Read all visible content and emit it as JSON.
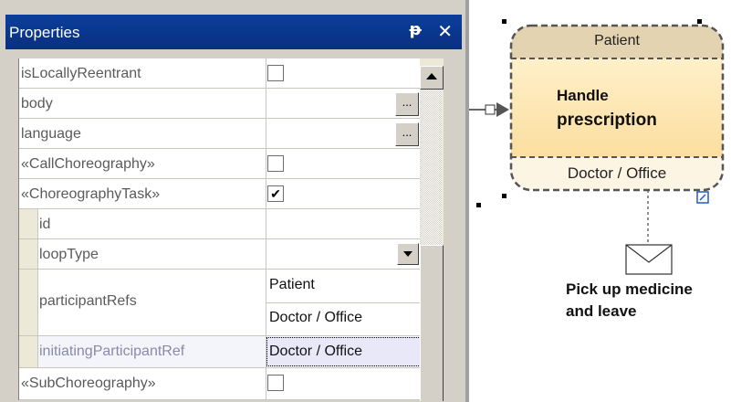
{
  "panel": {
    "title": "Properties",
    "pin_glyph": "ᵽ",
    "close_glyph": "✕",
    "rows": [
      {
        "name": "isLocallyReentrant"
      },
      {
        "name": "body",
        "ellipsis": "..."
      },
      {
        "name": "language",
        "ellipsis": "..."
      },
      {
        "name": "«CallChoreography»"
      },
      {
        "name": "«ChoreographyTask»",
        "checkmark": "✔"
      },
      {
        "name": "id"
      },
      {
        "name": "loopType"
      },
      {
        "name": "participantRefs",
        "values": [
          "Patient",
          "Doctor / Office"
        ]
      },
      {
        "name": "initiatingParticipantRef",
        "value": "Doctor / Office"
      },
      {
        "name": "«SubChoreography»"
      }
    ]
  },
  "diagram": {
    "task": {
      "top_participant": "Patient",
      "name_line1": "Handle",
      "name_line2": "prescription",
      "bottom_participant": "Doctor / Office"
    },
    "message_label_line1": "Pick up medicine",
    "message_label_line2": "and leave",
    "icons": [
      "envelope-icon",
      "subprocess-marker-icon",
      "sequence-flow-arrow-icon"
    ]
  },
  "colors": {
    "title_bar": "#0b3f9c",
    "panel_bg": "#d4d0c8",
    "task_header": "#e4d3b0",
    "task_body_top": "#fff6d8",
    "task_body_bottom": "#fbd890",
    "selected_cell": "#e8e8f8"
  }
}
